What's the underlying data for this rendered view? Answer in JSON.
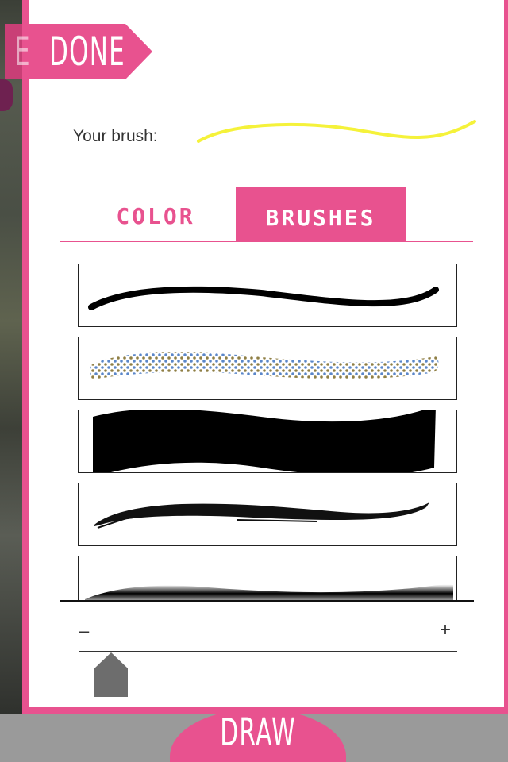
{
  "header": {
    "done_label": "DONE",
    "done_ghost_letter": "E"
  },
  "brush_preview": {
    "label": "Your brush:",
    "color": "#f5f23a"
  },
  "tabs": [
    {
      "label": "COLOR",
      "active": false
    },
    {
      "label": "BRUSHES",
      "active": true
    }
  ],
  "brushes": [
    {
      "name": "smooth-stroke"
    },
    {
      "name": "dotted-stroke"
    },
    {
      "name": "wide-flat-stroke"
    },
    {
      "name": "rough-ink-stroke"
    },
    {
      "name": "airbrush-stroke"
    }
  ],
  "size": {
    "minus_label": "–",
    "plus_label": "+",
    "value_fraction": 0.08
  },
  "footer": {
    "draw_label": "DRAW"
  },
  "colors": {
    "accent": "#e8528f",
    "bottom_bar": "#9a9a9a",
    "dots_a": "#5b87c9",
    "dots_b": "#8f7f45"
  }
}
